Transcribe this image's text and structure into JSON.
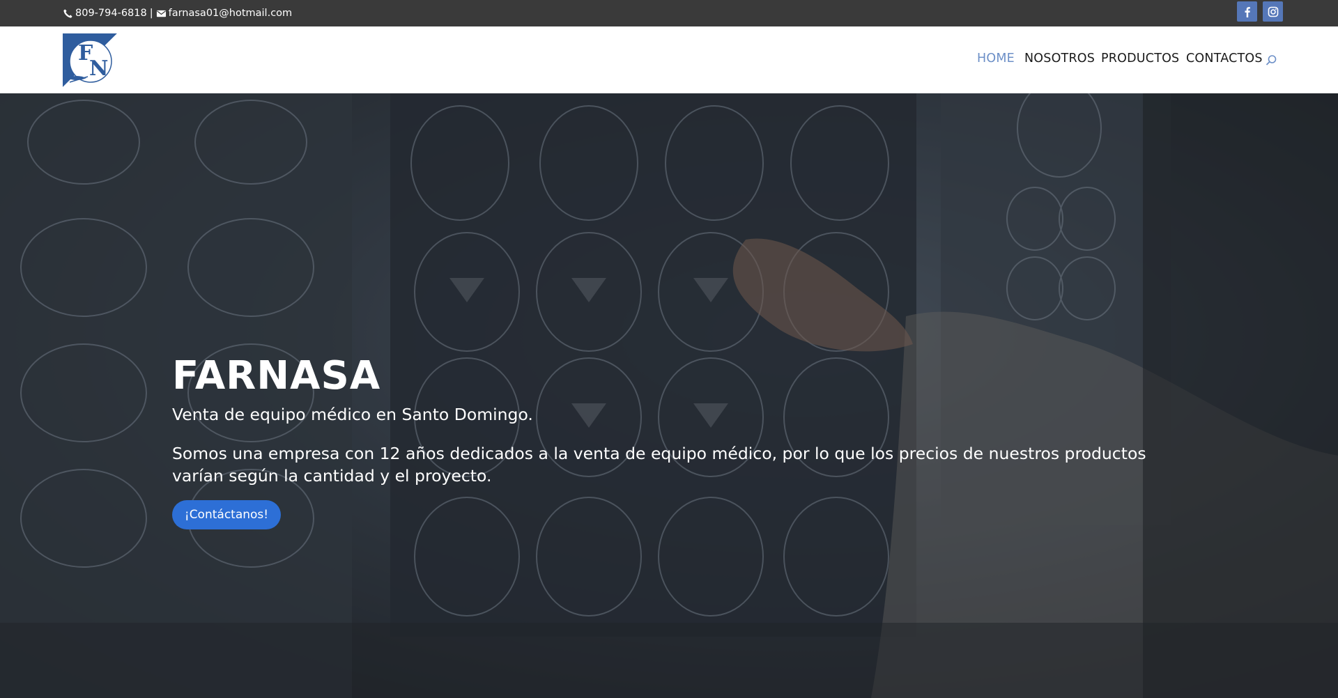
{
  "topbar": {
    "phone": "809-794-6818",
    "separator": "|",
    "email": "farnasa01@hotmail.com",
    "social": [
      {
        "icon": "facebook-icon"
      },
      {
        "icon": "instagram-icon"
      }
    ]
  },
  "header": {
    "logo_text": "FN",
    "nav": [
      {
        "label": "HOME",
        "active": true
      },
      {
        "label": "NOSOTROS",
        "active": false
      },
      {
        "label": "PRODUCTOS",
        "active": false
      },
      {
        "label": "CONTACTOS",
        "active": false
      }
    ],
    "search_icon": "search-icon"
  },
  "hero": {
    "title": "FARNASA",
    "subtitle": "Venta de equipo médico en Santo Domingo.",
    "description": "Somos una empresa con 12 años dedicados a la venta de equipo médico, por lo que los precios de nuestros productos varían según la cantidad y el proyecto.",
    "button_label": "¡Contáctanos!"
  },
  "colors": {
    "topbar_bg": "#3a3a3a",
    "nav_active": "#6c8fc7",
    "button_bg": "#2d6fd6",
    "social_bg": "#5577b8"
  }
}
